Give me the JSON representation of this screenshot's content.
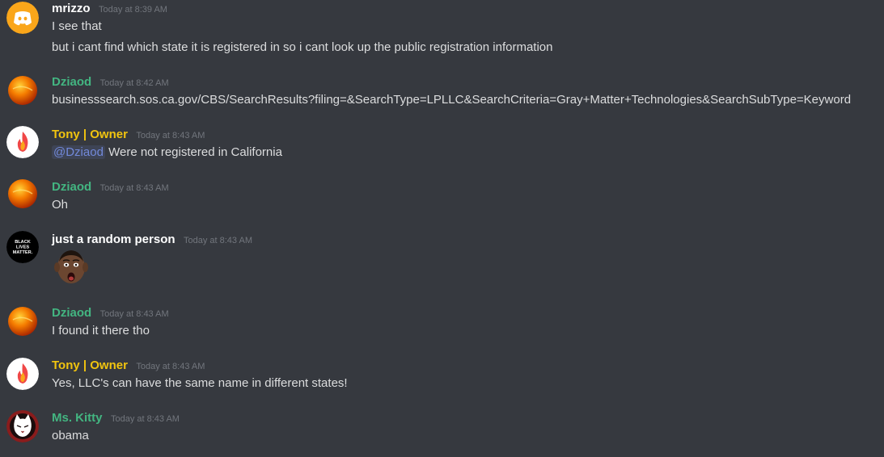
{
  "colors": {
    "background": "#36393f",
    "text": "#dcddde",
    "timestamp": "#72767d",
    "mention": "#7289da",
    "user_default": "#ffffff",
    "role_green": "#43b581",
    "role_gold": "#f1c40f"
  },
  "messages": [
    {
      "username": "mrizzo",
      "timestamp": "Today at 8:39 AM",
      "avatar_icon": "discord-logo-icon",
      "lines": [
        "I see that",
        "but i cant find which state it is registered in so i cant look up the public registration information"
      ]
    },
    {
      "username": "Dziaod",
      "timestamp": "Today at 8:42 AM",
      "avatar_icon": "orange-planet-avatar",
      "lines": [
        "businesssearch.sos.ca.gov/CBS/SearchResults?filing=&SearchType=LPLLC&SearchCriteria=Gray+Matter+Technologies&SearchSubType=Keyword"
      ]
    },
    {
      "username": "Tony | Owner",
      "timestamp": "Today at 8:43 AM",
      "avatar_icon": "flame-avatar",
      "mention": "@Dziaod",
      "lines": [
        "Were not registered in California"
      ]
    },
    {
      "username": "Dziaod",
      "timestamp": "Today at 8:43 AM",
      "avatar_icon": "orange-planet-avatar",
      "lines": [
        "Oh"
      ]
    },
    {
      "username": "just a random person",
      "timestamp": "Today at 8:43 AM",
      "avatar_icon": "black-lives-matter-avatar",
      "avatar_text": [
        "BLACK",
        "LIVES",
        "MATTER."
      ],
      "emoji": "surprised-face-emoji"
    },
    {
      "username": "Dziaod",
      "timestamp": "Today at 8:43 AM",
      "avatar_icon": "orange-planet-avatar",
      "lines": [
        "I found it there tho"
      ]
    },
    {
      "username": "Tony | Owner",
      "timestamp": "Today at 8:43 AM",
      "avatar_icon": "flame-avatar",
      "lines": [
        "Yes, LLC's can have the same name in different states!"
      ]
    },
    {
      "username": "Ms. Kitty",
      "timestamp": "Today at 8:43 AM",
      "avatar_icon": "cat-avatar",
      "lines": [
        "obama"
      ]
    }
  ]
}
